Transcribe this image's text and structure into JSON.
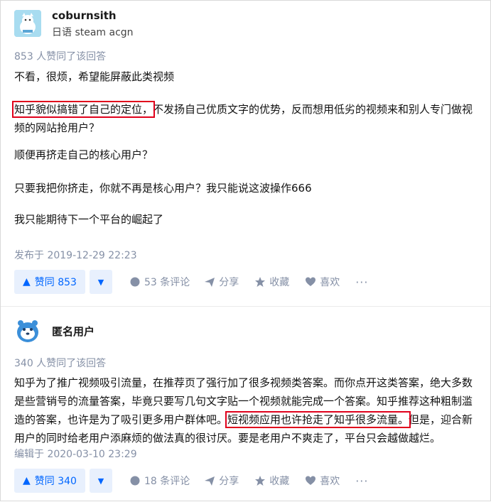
{
  "answer1": {
    "author": {
      "name": "coburnsith",
      "bio": "日语 steam acgn"
    },
    "votes_line": "853 人赞同了该回答",
    "paragraphs": {
      "p1": "不看，很烦，希望能屏蔽此类视频",
      "p2_highlight": "知乎貌似搞错了自己的定位，",
      "p2_rest": "不发扬自己优质文字的优势，反而想用低劣的视频来和别人专门做视频的网站抢用户？",
      "p3": "顺便再挤走自己的核心用户？",
      "p4": "只要我把你挤走，你就不再是核心用户？我只能说这波操作666",
      "p5": "我只能期待下一个平台的崛起了"
    },
    "date": "发布于 2019-12-29 22:23",
    "actions": {
      "vote_up": "赞同 853",
      "comments": "53 条评论",
      "share": "分享",
      "favorite": "收藏",
      "like": "喜欢",
      "more": "···"
    }
  },
  "answer2": {
    "author": {
      "name": "匿名用户"
    },
    "votes_line": "340 人赞同了该回答",
    "paragraphs": {
      "p1_before": "知乎为了推广视频吸引流量，在推荐页了强行加了很多视频类答案。而你点开这类答案，绝大多数是些营销号的流量答案，毕竟只要写几句文字贴一个视频就能完成一个答案。知乎推荐这种粗制滥造的答案，也许是为了吸引更多用户群体吧。",
      "p1_highlight": "短视频应用也许抢走了知乎很多流量。",
      "p1_after": "但是，迎合新用户的同时给老用户添麻烦的做法真的很讨厌。要是老用户不爽走了，平台只会越做越烂。"
    },
    "date": "编辑于 2020-03-10 23:29",
    "actions": {
      "vote_up": "赞同 340",
      "comments": "18 条评论",
      "share": "分享",
      "favorite": "收藏",
      "like": "喜欢",
      "more": "···"
    }
  },
  "colors": {
    "accent": "#0066ff",
    "vote_bg": "#e8f0fd",
    "meta": "#8590a6",
    "highlight_box": "#e0001b"
  }
}
